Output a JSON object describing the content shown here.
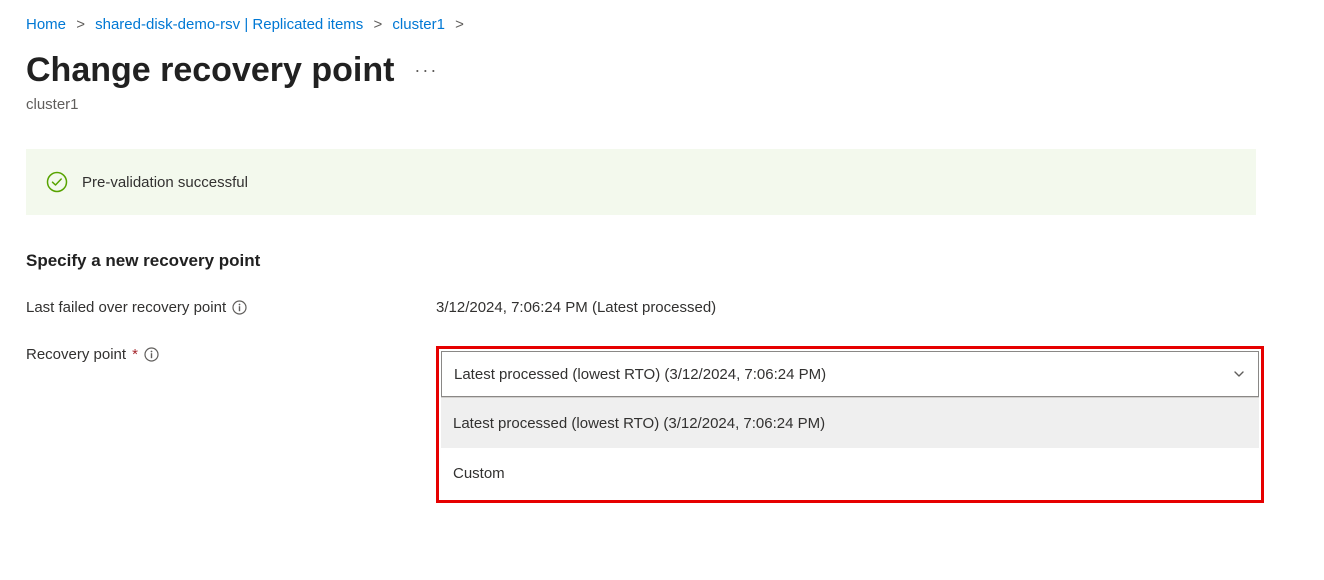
{
  "breadcrumb": {
    "items": [
      {
        "label": "Home"
      },
      {
        "label": "shared-disk-demo-rsv | Replicated items"
      },
      {
        "label": "cluster1"
      }
    ]
  },
  "header": {
    "title": "Change recovery point",
    "subtitle": "cluster1"
  },
  "status": {
    "message": "Pre-validation successful",
    "color_stroke": "#57a300"
  },
  "section": {
    "heading": "Specify a new recovery point"
  },
  "form": {
    "last_failed_over": {
      "label": "Last failed over recovery point",
      "value": "3/12/2024, 7:06:24 PM (Latest processed)"
    },
    "recovery_point": {
      "label": "Recovery point",
      "required_marker": "*",
      "selected": "Latest processed (lowest RTO) (3/12/2024, 7:06:24 PM)",
      "options": [
        "Latest processed (lowest RTO) (3/12/2024, 7:06:24 PM)",
        "Custom"
      ]
    }
  }
}
